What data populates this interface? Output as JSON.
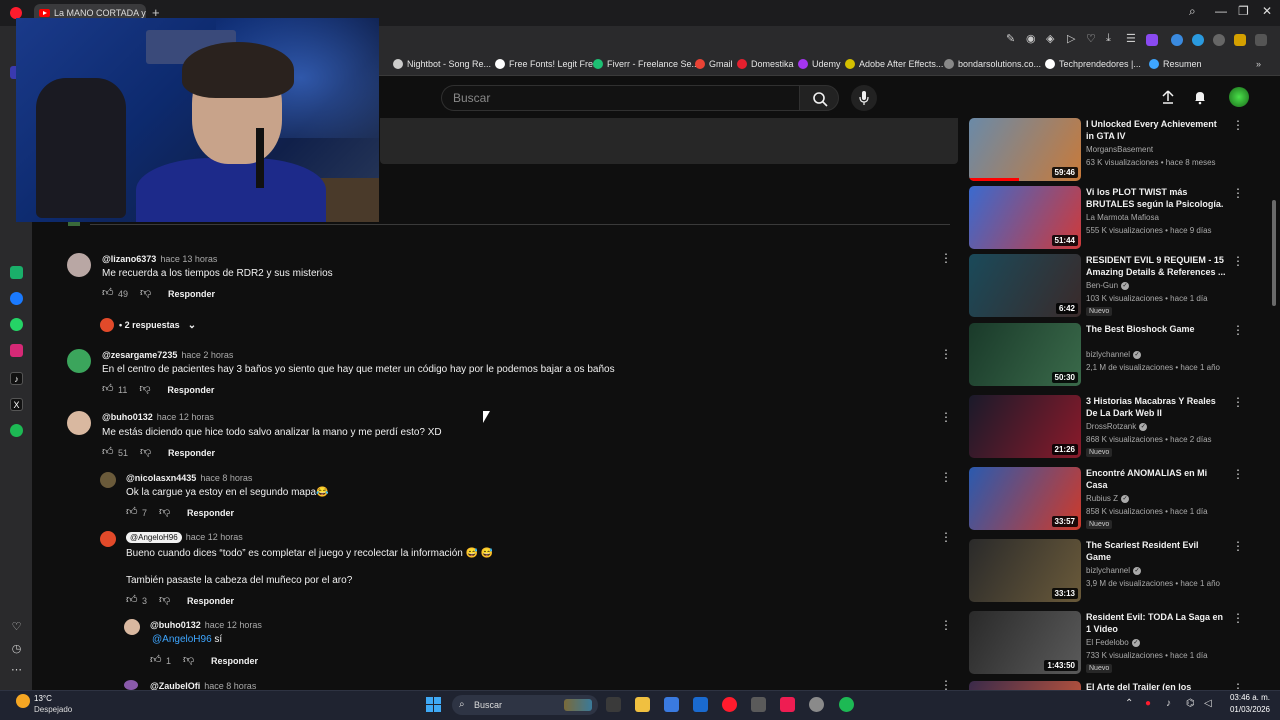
{
  "browser": {
    "tab_title": "La MANO CORTADA y el l",
    "bookmarks": [
      {
        "label": "Nightbot - Song Re...",
        "color": "#cccccc"
      },
      {
        "label": "Free Fonts! Legit Fre...",
        "color": "#ffffff"
      },
      {
        "label": "Fiverr - Freelance Se...",
        "color": "#1dbf73"
      },
      {
        "label": "Gmail",
        "color": "#ea4335"
      },
      {
        "label": "Domestika",
        "color": "#e5202e"
      },
      {
        "label": "Udemy",
        "color": "#a435f0"
      },
      {
        "label": "Adobe After Effects...",
        "color": "#d4c000"
      },
      {
        "label": "bondarsolutions.co...",
        "color": "#888888"
      },
      {
        "label": "Techprendedores |...",
        "color": "#ffffff"
      },
      {
        "label": "Resumen",
        "color": "#3ea6ff"
      }
    ]
  },
  "header": {
    "search_placeholder": "Buscar"
  },
  "comments": [
    {
      "author": "@lizano6373",
      "time": "hace 13 horas",
      "text": "Me recuerda a los tiempos de RDR2 y sus misterios",
      "likes": "49",
      "reply": "Responder",
      "avatar": "#b9a7a4"
    },
    {
      "author": "@zesargame7235",
      "time": "hace 2 horas",
      "text": "En el centro de pacientes hay 3 baños yo siento que hay que meter un código hay por le podemos bajar a os baños",
      "likes": "11",
      "reply": "Responder",
      "avatar": "#3ba55c"
    },
    {
      "author": "@buho0132",
      "time": "hace 12 horas",
      "text": "Me estás diciendo que hice todo salvo analizar la mano y me perdí esto? XD",
      "likes": "51",
      "reply": "Responder",
      "avatar": "#d9b8a0"
    }
  ],
  "replies_toggle": "2 respuestas",
  "replies": [
    {
      "author": "@nicolasxn4435",
      "time": "hace 8 horas",
      "text": "Ok la cargue ya estoy en el segundo mapa😂",
      "likes": "7",
      "reply": "Responder",
      "avatar": "#6a5a3a"
    },
    {
      "author": "@AngeloH96",
      "time": "hace 12 horas",
      "text": "Bueno cuando dices “todo” es completar el juego y recolectar la información 😅 😅",
      "text2": "También pasaste la cabeza del muñeco por el aro?",
      "likes": "3",
      "reply": "Responder",
      "avatar": "#e24a2a"
    },
    {
      "author": "@buho0132",
      "time": "hace 12 horas",
      "mention": "@AngeloH96",
      "text": " sí",
      "likes": "1",
      "reply": "Responder",
      "avatar": "#d9b8a0"
    },
    {
      "author": "@ZaubelOfi",
      "time": "hace 8 horas",
      "avatar": "#8a5aaa"
    }
  ],
  "recommendations": [
    {
      "title": "I Unlocked Every Achievement in GTA IV",
      "channel": "MorgansBasement",
      "verified": false,
      "meta": "63 K visualizaciones • hace 8 meses",
      "duration": "59:46",
      "badge": "",
      "progress": 0.45,
      "thumb": [
        "#6a8aa8",
        "#c87a3a"
      ]
    },
    {
      "title": "Vi los PLOT TWIST más BRUTALES según la Psicología.",
      "channel": "La Marmota Mafiosa",
      "verified": false,
      "meta": "555 K visualizaciones • hace 9 días",
      "duration": "51:44",
      "badge": "",
      "progress": 0,
      "thumb": [
        "#3a6acf",
        "#cf3a3a"
      ]
    },
    {
      "title": "RESIDENT EVIL 9 REQUIEM - 15 Amazing Details & References ...",
      "channel": "Ben-Gun",
      "verified": true,
      "meta": "103 K visualizaciones • hace 1 día",
      "duration": "6:42",
      "badge": "Nuevo",
      "progress": 0,
      "thumb": [
        "#1a4a5a",
        "#3a2a2a"
      ]
    },
    {
      "title": "The Best Bioshock Game",
      "channel": "bizlychannel",
      "verified": true,
      "meta": "2,1 M de visualizaciones • hace 1 año",
      "duration": "50:30",
      "badge": "",
      "progress": 0,
      "thumb": [
        "#1a3a2a",
        "#3a6a4a"
      ]
    },
    {
      "title": "3 Historias Macabras Y Reales De La Dark Web II",
      "channel": "DrossRotzank",
      "verified": true,
      "meta": "868 K visualizaciones • hace 2 días",
      "duration": "21:26",
      "badge": "Nuevo",
      "progress": 0,
      "thumb": [
        "#1a1a2a",
        "#8a1a2a"
      ]
    },
    {
      "title": "Encontré ANOMALIAS en Mi Casa",
      "channel": "Rubius Z",
      "verified": true,
      "meta": "858 K visualizaciones • hace 1 día",
      "duration": "33:57",
      "badge": "Nuevo",
      "progress": 0,
      "thumb": [
        "#2a5aaf",
        "#cf3a2a"
      ]
    },
    {
      "title": "The Scariest Resident Evil Game",
      "channel": "bizlychannel",
      "verified": true,
      "meta": "3,9 M de visualizaciones • hace 1 año",
      "duration": "33:13",
      "badge": "",
      "progress": 0,
      "thumb": [
        "#2a2a2a",
        "#6a5a3a"
      ]
    },
    {
      "title": "Resident Evil: TODA La Saga en 1 Video",
      "channel": "El Fedelobo",
      "verified": true,
      "meta": "733 K visualizaciones • hace 1 día",
      "duration": "1:43:50",
      "badge": "Nuevo",
      "progress": 0,
      "thumb": [
        "#2a2a2a",
        "#5a5a5a"
      ]
    },
    {
      "title": "El Arte del Trailer (en los",
      "channel": "",
      "verified": false,
      "meta": "",
      "duration": "",
      "badge": "",
      "progress": 0,
      "thumb": [
        "#3a2a4a",
        "#cf5a3a"
      ]
    }
  ],
  "taskbar": {
    "temperature": "13°C",
    "condition": "Despejado",
    "search_label": "Buscar",
    "time": "03:46 a. m.",
    "date": "01/03/2026"
  },
  "colors": {
    "accent": "#ff0000",
    "link": "#3ea6ff",
    "background": "#0f0f0f"
  }
}
